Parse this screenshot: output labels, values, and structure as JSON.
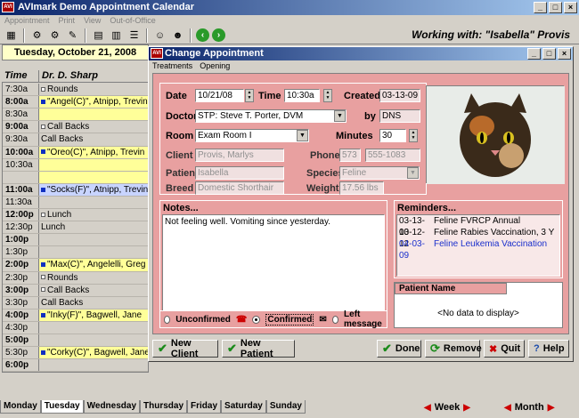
{
  "window": {
    "title": "AVImark Demo Appointment Calendar"
  },
  "menu": [
    "Appointment",
    "Print",
    "View",
    "Out-of-Office"
  ],
  "working_with": "Working with: \"Isabella\" Provis",
  "calendar": {
    "date": "Tuesday, October 21, 2008",
    "time_header": "Time",
    "doctor_header": "Dr. D. Sharp",
    "rows": [
      {
        "time": "7:30a",
        "entry": "Rounds",
        "style": "grey",
        "mark": "o"
      },
      {
        "time": "8:00a",
        "entry": "\"Angel(C)\", Atnipp, Trevin",
        "style": "yellow",
        "mark": "b",
        "hour": true
      },
      {
        "time": "8:30a",
        "entry": "",
        "style": "yellow"
      },
      {
        "time": "9:00a",
        "entry": "Call Backs",
        "style": "grey",
        "mark": "o",
        "hour": true
      },
      {
        "time": "9:30a",
        "entry": "Call Backs",
        "style": "grey"
      },
      {
        "time": "10:00a",
        "entry": "\"Oreo(C)\", Atnipp, Trevin",
        "style": "yellow",
        "mark": "b",
        "hour": true
      },
      {
        "time": "10:30a",
        "entry": "",
        "style": "yellow"
      },
      {
        "time": "",
        "entry": "",
        "style": "yellow"
      },
      {
        "time": "11:00a",
        "entry": "\"Socks(F)\", Atnipp, Trevin",
        "style": "blue",
        "mark": "b",
        "hour": true
      },
      {
        "time": "11:30a",
        "entry": "",
        "style": "grey"
      },
      {
        "time": "12:00p",
        "entry": "Lunch",
        "style": "grey",
        "mark": "o",
        "hour": true
      },
      {
        "time": "12:30p",
        "entry": "Lunch",
        "style": "grey"
      },
      {
        "time": "1:00p",
        "entry": "",
        "style": "grey",
        "hour": true
      },
      {
        "time": "1:30p",
        "entry": "",
        "style": "grey"
      },
      {
        "time": "2:00p",
        "entry": "\"Max(C)\", Angelelli, Greg",
        "style": "yellow",
        "mark": "b",
        "hour": true
      },
      {
        "time": "2:30p",
        "entry": "Rounds",
        "style": "grey",
        "mark": "o"
      },
      {
        "time": "3:00p",
        "entry": "Call Backs",
        "style": "grey",
        "mark": "o",
        "hour": true
      },
      {
        "time": "3:30p",
        "entry": "Call Backs",
        "style": "grey"
      },
      {
        "time": "4:00p",
        "entry": "\"Inky(F)\", Bagwell, Jane",
        "style": "yellow",
        "mark": "b",
        "hour": true
      },
      {
        "time": "4:30p",
        "entry": "",
        "style": "grey"
      },
      {
        "time": "5:00p",
        "entry": "",
        "style": "grey",
        "hour": true
      },
      {
        "time": "5:30p",
        "entry": "\"Corky(C)\", Bagwell, Jane",
        "style": "yellow",
        "mark": "b"
      },
      {
        "time": "6:00p",
        "entry": "",
        "style": "grey",
        "hour": true
      }
    ]
  },
  "day_tabs": [
    "Monday",
    "Tuesday",
    "Wednesday",
    "Thursday",
    "Friday",
    "Saturday",
    "Sunday"
  ],
  "active_tab": "Tuesday",
  "nav": {
    "week": "Week",
    "month": "Month"
  },
  "dialog": {
    "title": "Change Appointment",
    "menu": [
      "Treatments",
      "Opening"
    ],
    "date_label": "Date",
    "date": "10/21/08",
    "time_label": "Time",
    "time": "10:30a",
    "created_label": "Created",
    "created": "03-13-09",
    "doctor_label": "Doctor",
    "doctor": "STP: Steve T. Porter, DVM",
    "by_label": "by",
    "by": "DNS",
    "room_label": "Room",
    "room": "Exam Room I",
    "minutes_label": "Minutes",
    "minutes": "30",
    "client_label": "Client",
    "client": "Provis, Marlys",
    "phone_label": "Phone",
    "phone_area": "573",
    "phone_num": "555-1083",
    "patient_label": "Patient",
    "patient": "Isabella",
    "species_label": "Species",
    "species": "Feline",
    "breed_label": "Breed",
    "breed": "Domestic Shorthair",
    "weight_label": "Weight",
    "weight": "17.56 lbs",
    "notes_title": "Notes...",
    "notes": "Not feeling well.  Vomiting since yesterday.",
    "reminders_title": "Reminders...",
    "reminders": [
      {
        "date": "03-13-10",
        "text": "Feline FVRCP Annual",
        "blue": false
      },
      {
        "date": "03-12-12",
        "text": "Feline Rabies Vaccination, 3 Y",
        "blue": false
      },
      {
        "date": "04-03-09",
        "text": "Feline Leukemia Vaccination",
        "blue": true
      }
    ],
    "patient_name_title": "Patient Name",
    "patient_col": "Patient Name",
    "no_data": "<No data to display>",
    "status": {
      "unconfirmed": "Unconfirmed",
      "confirmed": "Confirmed",
      "left_message": "Left message",
      "selected": "Confirmed"
    },
    "buttons": {
      "new_client": "New Client",
      "new_patient": "New Patient",
      "done": "Done",
      "remove": "Remove",
      "quit": "Quit",
      "help": "Help"
    }
  }
}
